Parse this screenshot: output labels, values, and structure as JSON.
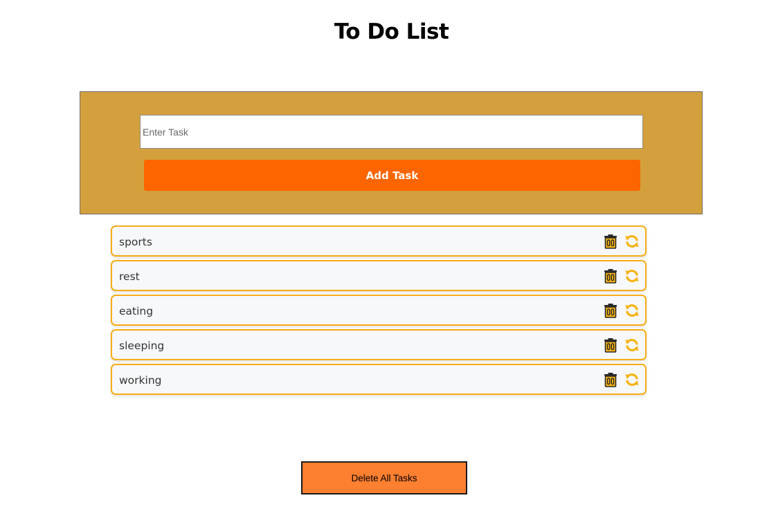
{
  "header": {
    "title": "To Do List"
  },
  "input_panel": {
    "placeholder": "Enter Task",
    "value": "",
    "add_button_label": "Add Task",
    "background_color": "#d4a03d",
    "button_color": "#fc6500"
  },
  "tasks": [
    {
      "text": "sports",
      "delete_icon": "trash-icon",
      "edit_icon": "refresh-icon"
    },
    {
      "text": "rest",
      "delete_icon": "trash-icon",
      "edit_icon": "refresh-icon"
    },
    {
      "text": "eating",
      "delete_icon": "trash-icon",
      "edit_icon": "refresh-icon"
    },
    {
      "text": "sleeping",
      "delete_icon": "trash-icon",
      "edit_icon": "refresh-icon"
    },
    {
      "text": "working",
      "delete_icon": "trash-icon",
      "edit_icon": "refresh-icon"
    }
  ],
  "footer": {
    "delete_all_label": "Delete All Tasks",
    "button_color": "#fd7f30"
  },
  "colors": {
    "task_border": "#f7ac14",
    "icon_color": "#f7b20f"
  }
}
